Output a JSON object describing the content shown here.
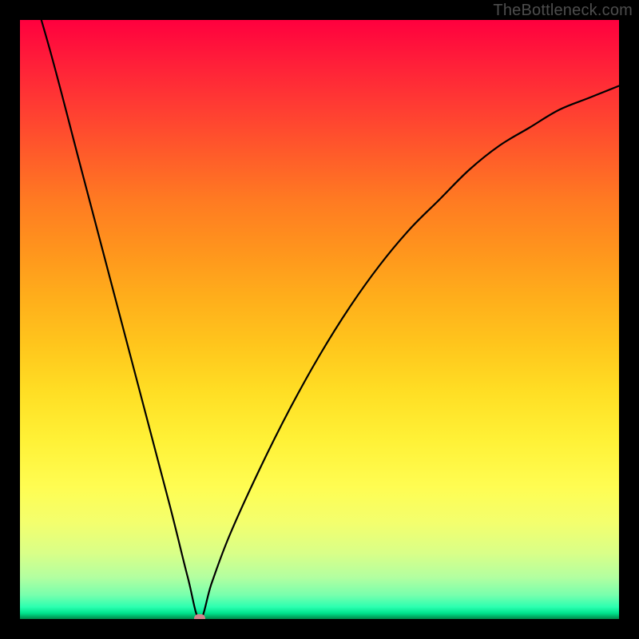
{
  "watermark": "TheBottleneck.com",
  "colors": {
    "background": "#000000",
    "curve": "#000000",
    "marker": "#d1838c"
  },
  "chart_data": {
    "type": "line",
    "title": "",
    "xlabel": "",
    "ylabel": "",
    "xlim": [
      0,
      100
    ],
    "ylim": [
      0,
      100
    ],
    "annotations": [
      {
        "name": "minimum-marker",
        "x": 30,
        "y": 0
      }
    ],
    "series": [
      {
        "name": "bottleneck-curve",
        "x": [
          0,
          5,
          10,
          15,
          20,
          25,
          28,
          30,
          32,
          35,
          40,
          45,
          50,
          55,
          60,
          65,
          70,
          75,
          80,
          85,
          90,
          95,
          100
        ],
        "values": [
          112,
          95,
          76,
          57,
          38,
          19,
          7,
          0,
          6,
          14,
          25,
          35,
          44,
          52,
          59,
          65,
          70,
          75,
          79,
          82,
          85,
          87,
          89
        ]
      }
    ],
    "background_gradient": {
      "top": "#ff003e",
      "mid": "#ffde24",
      "bottom": "#008a4a"
    }
  }
}
